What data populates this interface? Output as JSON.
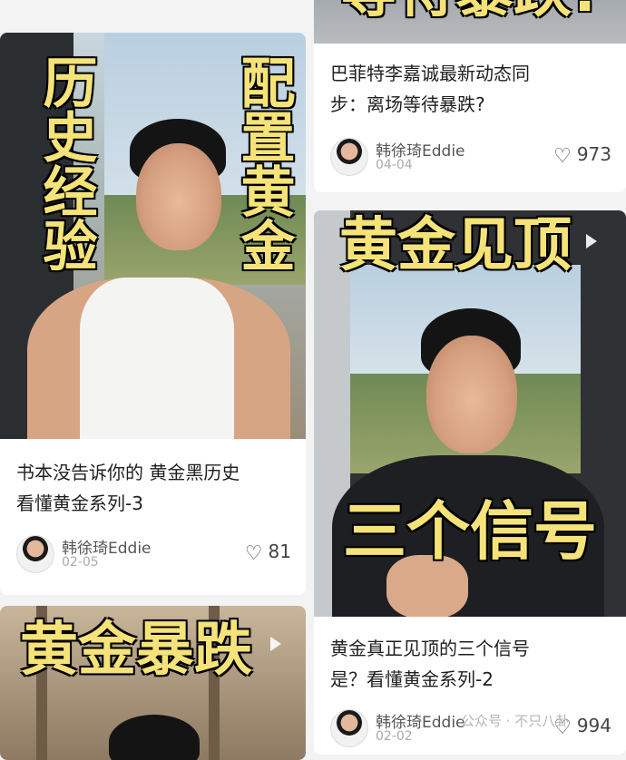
{
  "cards": [
    {
      "id": "gold-history",
      "captions": [
        "历史经验",
        "配置黄金"
      ],
      "title_lines": [
        "书本没告诉你的 黄金黑历史",
        "看懂黄金系列-3"
      ],
      "author": "韩徐琦Eddie",
      "date": "02-05",
      "likes": "81"
    },
    {
      "id": "gold-crash",
      "captions": [
        "黄金暴跌"
      ],
      "title_lines": [],
      "author": "",
      "date": "",
      "likes": ""
    },
    {
      "id": "buffett-li",
      "captions": [
        "等待暴跌!"
      ],
      "title_lines": [
        "巴菲特李嘉诚最新动态同",
        "步：离场等待暴跌?"
      ],
      "author": "韩徐琦Eddie",
      "date": "04-04",
      "likes": "973"
    },
    {
      "id": "gold-peak",
      "captions": [
        "黄金见顶",
        "三个信号"
      ],
      "title_lines": [
        "黄金真正见顶的三个信号",
        "是？看懂黄金系列-2"
      ],
      "author": "韩徐琦Eddie",
      "date": "02-02",
      "likes": "994"
    }
  ],
  "watermark": "公众号 · 不只八卦",
  "icons": {
    "like": "heart-outline-icon",
    "play": "play-icon"
  }
}
